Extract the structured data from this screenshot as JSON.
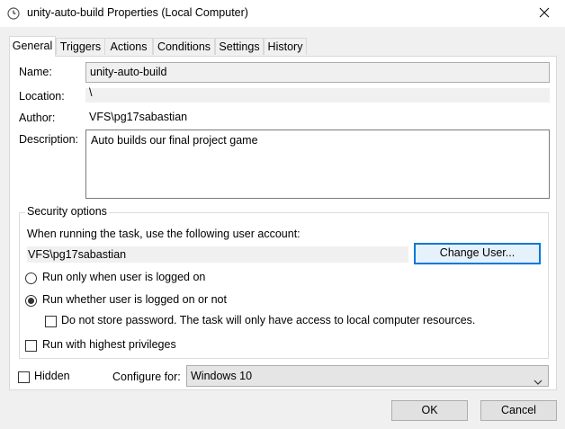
{
  "window": {
    "title": "unity-auto-build Properties (Local Computer)",
    "icon": "task-scheduler-clock-icon"
  },
  "tabs": [
    {
      "label": "General",
      "active": true
    },
    {
      "label": "Triggers",
      "active": false
    },
    {
      "label": "Actions",
      "active": false
    },
    {
      "label": "Conditions",
      "active": false
    },
    {
      "label": "Settings",
      "active": false
    },
    {
      "label": "History",
      "active": false
    }
  ],
  "general": {
    "name_label": "Name:",
    "name_value": "unity-auto-build",
    "location_label": "Location:",
    "location_value": "\\",
    "author_label": "Author:",
    "author_value": "VFS\\pg17sabastian",
    "description_label": "Description:",
    "description_value": "Auto builds our final project game"
  },
  "security": {
    "legend": "Security options",
    "account_prompt": "When running the task, use the following user account:",
    "account_value": "VFS\\pg17sabastian",
    "change_user_label": "Change User...",
    "radio_logged_on": {
      "label": "Run only when user is logged on",
      "checked": false
    },
    "radio_whether": {
      "label": "Run whether user is logged on or not",
      "checked": true
    },
    "no_store_password": {
      "label": "Do not store password.  The task will only have access to local computer resources.",
      "checked": false
    },
    "highest_privileges": {
      "label": "Run with highest privileges",
      "checked": false
    }
  },
  "bottom": {
    "hidden": {
      "label": "Hidden",
      "checked": false
    },
    "configure_label": "Configure for:",
    "configure_value": "Windows 10"
  },
  "buttons": {
    "ok": "OK",
    "cancel": "Cancel"
  },
  "colors": {
    "focus_blue": "#0078d7",
    "button_face": "#e1e1e1",
    "dialog_bg": "#f0f0f0"
  }
}
